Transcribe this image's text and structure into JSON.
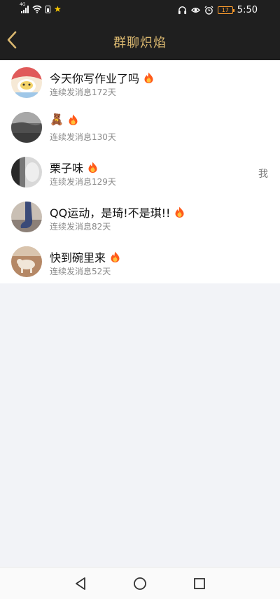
{
  "status_bar": {
    "network": "4G",
    "time": "5:50",
    "battery": "17",
    "icons": [
      "signal-icon",
      "wifi-icon",
      "sim-icon",
      "star-icon",
      "headphones-icon",
      "eye-icon",
      "alarm-icon",
      "battery-icon"
    ]
  },
  "header": {
    "title": "群聊炽焰",
    "back_icon": "chevron-left-icon"
  },
  "groups": [
    {
      "name": "今天你写作业了吗",
      "streak": "连续发消息172天",
      "badge": "fire-icon",
      "avatar": "cartoon-avatar",
      "right": ""
    },
    {
      "name": "🧸",
      "streak": "连续发消息130天",
      "badge": "fire-icon",
      "avatar": "landscape-avatar",
      "right": ""
    },
    {
      "name": "栗子味",
      "streak": "连续发消息129天",
      "badge": "fire-icon",
      "avatar": "bw-photo-avatar",
      "right": "我"
    },
    {
      "name": "QQ运动，是琦!不是琪!!",
      "streak": "连续发消息82天",
      "badge": "fire-icon",
      "avatar": "sock-photo-avatar",
      "right": ""
    },
    {
      "name": "快到碗里来",
      "streak": "连续发消息52天",
      "badge": "fire-icon",
      "avatar": "dog-photo-avatar",
      "right": ""
    }
  ],
  "nav": {
    "back": "triangle-back-icon",
    "home": "circle-home-icon",
    "recents": "square-recents-icon"
  },
  "colors": {
    "header_bg": "#1f1f1f",
    "title": "#d9b76f",
    "fire": "#ff6a1a",
    "page_bg": "#f2f3f7"
  }
}
